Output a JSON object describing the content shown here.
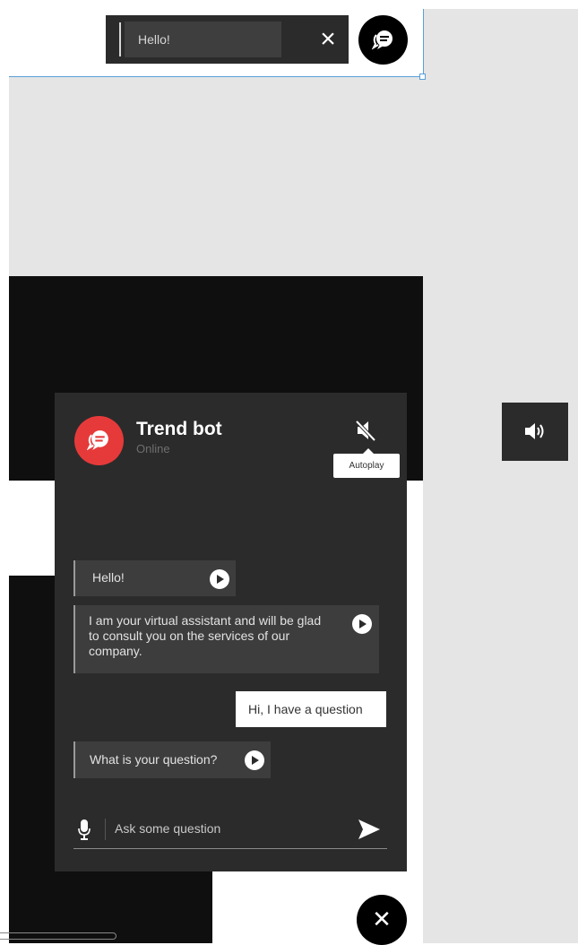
{
  "preview": {
    "message": "Hello!",
    "close_icon": "close-icon",
    "launcher_icon": "chat-bubbles-icon"
  },
  "side": {
    "sound_icon": "speaker-icon"
  },
  "chat": {
    "bot_name": "Trend bot",
    "status": "Online",
    "mute_icon": "speaker-muted-icon",
    "autoplay_label": "Autoplay",
    "accent_color": "#e63a3a",
    "messages": [
      {
        "from": "bot",
        "text": "Hello!"
      },
      {
        "from": "bot",
        "text": "I am your virtual assistant and will be glad to consult you on the services of our company."
      },
      {
        "from": "user",
        "text": "Hi, I have a question"
      },
      {
        "from": "bot",
        "text": "What is your question?"
      }
    ],
    "input": {
      "value": "",
      "placeholder": "Ask some question"
    },
    "mic_icon": "microphone-icon",
    "send_icon": "send-icon",
    "close_icon": "close-icon"
  }
}
